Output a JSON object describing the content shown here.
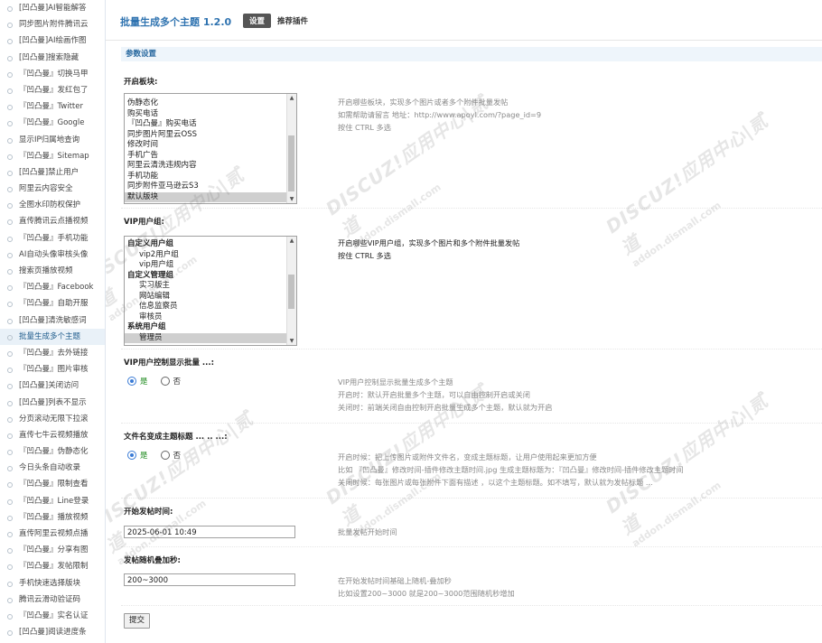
{
  "sidebar": {
    "items": [
      {
        "label": "[凹凸曼]AI智能解答",
        "active": false
      },
      {
        "label": "同步图片附件腾讯云",
        "active": false
      },
      {
        "label": "[凹凸曼]AI绘画作图",
        "active": false
      },
      {
        "label": "[凹凸曼]搜索隐藏",
        "active": false
      },
      {
        "label": "『凹凸曼』切换马甲",
        "active": false
      },
      {
        "label": "『凹凸曼』发红包了",
        "active": false
      },
      {
        "label": "『凹凸曼』Twitter",
        "active": false
      },
      {
        "label": "『凹凸曼』Google",
        "active": false
      },
      {
        "label": "显示IP归属地查询",
        "active": false
      },
      {
        "label": "『凹凸曼』Sitemap",
        "active": false
      },
      {
        "label": "[凹凸曼]禁止用户",
        "active": false
      },
      {
        "label": "阿里云内容安全",
        "active": false
      },
      {
        "label": "全图水印防权保护",
        "active": false
      },
      {
        "label": "直传腾讯云点播视频",
        "active": false
      },
      {
        "label": "『凹凸曼』手机功能",
        "active": false
      },
      {
        "label": "AI自动头像审核头像",
        "active": false
      },
      {
        "label": "搜索页播放视频",
        "active": false
      },
      {
        "label": "『凹凸曼』Facebook",
        "active": false
      },
      {
        "label": "『凹凸曼』自助开服",
        "active": false
      },
      {
        "label": "[凹凸曼]清洗敏感词",
        "active": false
      },
      {
        "label": "批量生成多个主题",
        "active": true
      },
      {
        "label": "『凹凸曼』去外链接",
        "active": false
      },
      {
        "label": "『凹凸曼』图片审核",
        "active": false
      },
      {
        "label": "[凹凸曼]关闭访问",
        "active": false
      },
      {
        "label": "[凹凸曼]列表不显示",
        "active": false
      },
      {
        "label": "分页滚动无限下拉滚",
        "active": false
      },
      {
        "label": "直传七牛云视频播放",
        "active": false
      },
      {
        "label": "『凹凸曼』伪静态化",
        "active": false
      },
      {
        "label": "今日头条自动收录",
        "active": false
      },
      {
        "label": "『凹凸曼』限制查看",
        "active": false
      },
      {
        "label": "『凹凸曼』Line登录",
        "active": false
      },
      {
        "label": "『凹凸曼』播放视频",
        "active": false
      },
      {
        "label": "直传阿里云视频点播",
        "active": false
      },
      {
        "label": "『凹凸曼』分享有图",
        "active": false
      },
      {
        "label": "『凹凸曼』发帖限制",
        "active": false
      },
      {
        "label": "手机快速选择版块",
        "active": false
      },
      {
        "label": "腾讯云滑动验证码",
        "active": false
      },
      {
        "label": "『凹凸曼』实名认证",
        "active": false
      },
      {
        "label": "[凹凸曼]阅读进度条",
        "active": false
      }
    ]
  },
  "header": {
    "title": "批量生成多个主题 1.2.0",
    "tab_settings": "设置",
    "tab_plugins": "推荐插件"
  },
  "section_title": "参数设置",
  "settings": {
    "modules": {
      "label": "开启板块:",
      "options": [
        {
          "text": "伪静态化",
          "selected": false
        },
        {
          "text": "购买电话",
          "selected": false
        },
        {
          "text": "『凹凸曼』购买电话",
          "selected": false
        },
        {
          "text": "同步图片阿里云OSS",
          "selected": false
        },
        {
          "text": "修改时间",
          "selected": false
        },
        {
          "text": "手机广告",
          "selected": false
        },
        {
          "text": "阿里云清洗违规内容",
          "selected": false
        },
        {
          "text": "手机功能",
          "selected": false
        },
        {
          "text": "同步附件亚马逊云S3",
          "selected": false
        },
        {
          "text": "默认版块",
          "selected": true
        }
      ],
      "desc": [
        "开启哪些板块，实现多个图片或者多个附件批量发帖",
        "如需帮助请留言 地址：http://www.apoyl.com/?page_id=9",
        "按住 CTRL 多选"
      ]
    },
    "vip_groups": {
      "label": "VIP用户组:",
      "options": [
        {
          "text": "自定义用户组",
          "group": true,
          "selected": false
        },
        {
          "text": "vip2用户组",
          "group": false,
          "selected": false
        },
        {
          "text": "vip用户组",
          "group": false,
          "selected": false
        },
        {
          "text": "自定义管理组",
          "group": true,
          "selected": false
        },
        {
          "text": "实习版主",
          "group": false,
          "selected": false
        },
        {
          "text": "网站编辑",
          "group": false,
          "selected": false
        },
        {
          "text": "信息监察员",
          "group": false,
          "selected": false
        },
        {
          "text": "审核员",
          "group": false,
          "selected": false
        },
        {
          "text": "系统用户组",
          "group": true,
          "selected": false
        },
        {
          "text": "管理员",
          "group": false,
          "selected": true
        }
      ],
      "desc": [
        "开启哪些VIP用户组，实现多个图片和多个附件批量发帖",
        "按住 CTRL 多选"
      ]
    },
    "vip_control": {
      "label": "VIP用户控制显示批量 ...:",
      "yes": "是",
      "no": "否",
      "value": "yes",
      "desc": [
        "VIP用户控制显示批量生成多个主题",
        "开启时：默认开启批量多个主题，可以自由控制开启或关闭",
        "关闭时：前端关闭自由控制开启批量生成多个主题，默认就为开启"
      ]
    },
    "filename_title": {
      "label": "文件名变成主题标题 ... .. ...:",
      "yes": "是",
      "no": "否",
      "value": "yes",
      "desc": [
        "开启时候：把上传图片或附件文件名，变成主题标题，让用户使用起来更加方便",
        "比如 『凹凸曼』修改时间-插件修改主题时间.jpg 生成主题标题为：『凹凸曼』修改时间-插件修改主题时间",
        "关闭时候：每张图片或每张附件下面有描述 ，以这个主题标题。如不填写，默认就为发帖标题 ..."
      ]
    },
    "start_time": {
      "label": "开始发帖时间:",
      "value": "2025-06-01 10:49",
      "desc": [
        "批量发帖开始时间"
      ]
    },
    "random_seconds": {
      "label": "发帖随机叠加秒:",
      "value": "200~3000",
      "desc": [
        "在开始发帖时间基础上随机-叠加秒",
        "比如设置200~3000 就是200~3000范围随机秒增加"
      ]
    }
  },
  "submit_label": "提交",
  "watermark": {
    "brand": "DISCUZ!应用中心|贰道",
    "domain": "addon.dismall.com"
  }
}
